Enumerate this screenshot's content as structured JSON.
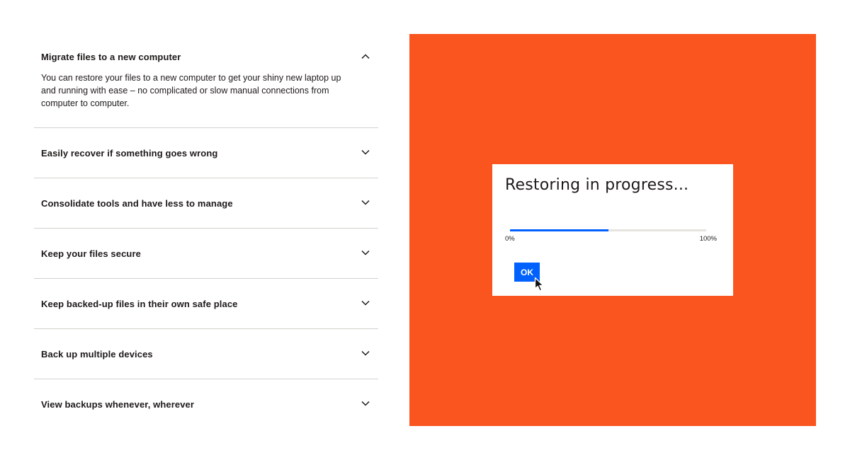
{
  "accordion": {
    "items": [
      {
        "title": "Migrate files to a new computer",
        "expanded": true,
        "icon": "chevron-up-icon",
        "body": "You can restore your files to a new computer to get your shiny new laptop up and running with ease – no complicated or slow manual connections from computer to computer."
      },
      {
        "title": "Easily recover if something goes wrong",
        "expanded": false,
        "icon": "chevron-down-icon"
      },
      {
        "title": "Consolidate tools and have less to manage",
        "expanded": false,
        "icon": "chevron-down-icon"
      },
      {
        "title": "Keep your files secure",
        "expanded": false,
        "icon": "chevron-down-icon"
      },
      {
        "title": "Keep backed-up files in their own safe place",
        "expanded": false,
        "icon": "chevron-down-icon"
      },
      {
        "title": "Back up multiple devices",
        "expanded": false,
        "icon": "chevron-down-icon"
      },
      {
        "title": "View backups whenever, wherever",
        "expanded": false,
        "icon": "chevron-down-icon"
      }
    ]
  },
  "illustration": {
    "background_color": "#fa551e",
    "dialog": {
      "title": "Restoring in progress...",
      "progress": {
        "min_label": "0%",
        "max_label": "100%",
        "value_fraction": 0.5,
        "fill_color": "#0061fe",
        "track_color": "#e6e4df"
      },
      "ok_button": "OK",
      "button_color": "#0061fe",
      "cursor_icon": "mouse-pointer-icon"
    }
  }
}
